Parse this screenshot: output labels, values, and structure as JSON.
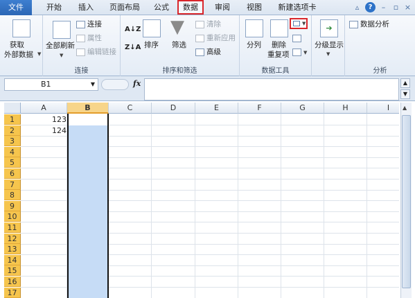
{
  "tabs": [
    {
      "id": "file",
      "label": "文件"
    },
    {
      "id": "home",
      "label": "开始"
    },
    {
      "id": "insert",
      "label": "插入"
    },
    {
      "id": "pagelayout",
      "label": "页面布局"
    },
    {
      "id": "formulas",
      "label": "公式"
    },
    {
      "id": "data",
      "label": "数据"
    },
    {
      "id": "review",
      "label": "审阅"
    },
    {
      "id": "view",
      "label": "视图"
    },
    {
      "id": "newtab",
      "label": "新建选项卡"
    }
  ],
  "ribbon": {
    "get_external": {
      "line1": "获取",
      "line2": "外部数据"
    },
    "connections": {
      "refresh_all": "全部刷新",
      "connections": "连接",
      "properties": "属性",
      "edit_links": "编辑链接",
      "group_label": "连接"
    },
    "sort_filter": {
      "sort": "排序",
      "filter": "筛选",
      "clear": "清除",
      "reapply": "重新应用",
      "advanced": "高级",
      "group_label": "排序和筛选"
    },
    "data_tools": {
      "text_to_columns": "分列",
      "remove_dup_1": "删除",
      "remove_dup_2": "重复项",
      "group_label": "数据工具"
    },
    "outline": {
      "label": "分级显示"
    },
    "analysis": {
      "data_analysis": "数据分析",
      "group_label": "分析"
    }
  },
  "formula_bar": {
    "name_box": "B1",
    "fx": "fx",
    "value": ""
  },
  "sheet": {
    "columns": [
      "A",
      "B",
      "C",
      "D",
      "E",
      "F",
      "G",
      "H",
      "I"
    ],
    "rows": [
      "1",
      "2",
      "3",
      "4",
      "5",
      "6",
      "7",
      "8",
      "9",
      "10",
      "11",
      "12",
      "13",
      "14",
      "15",
      "16",
      "17"
    ],
    "cells": {
      "A1": "123",
      "A2": "124"
    },
    "selected_column": "B",
    "active_cell": "B1"
  },
  "colors": {
    "accent": "#2b66b5",
    "highlight": "#d9262b",
    "row_header": "#f6c54d",
    "selection": "#c6dcf6"
  }
}
